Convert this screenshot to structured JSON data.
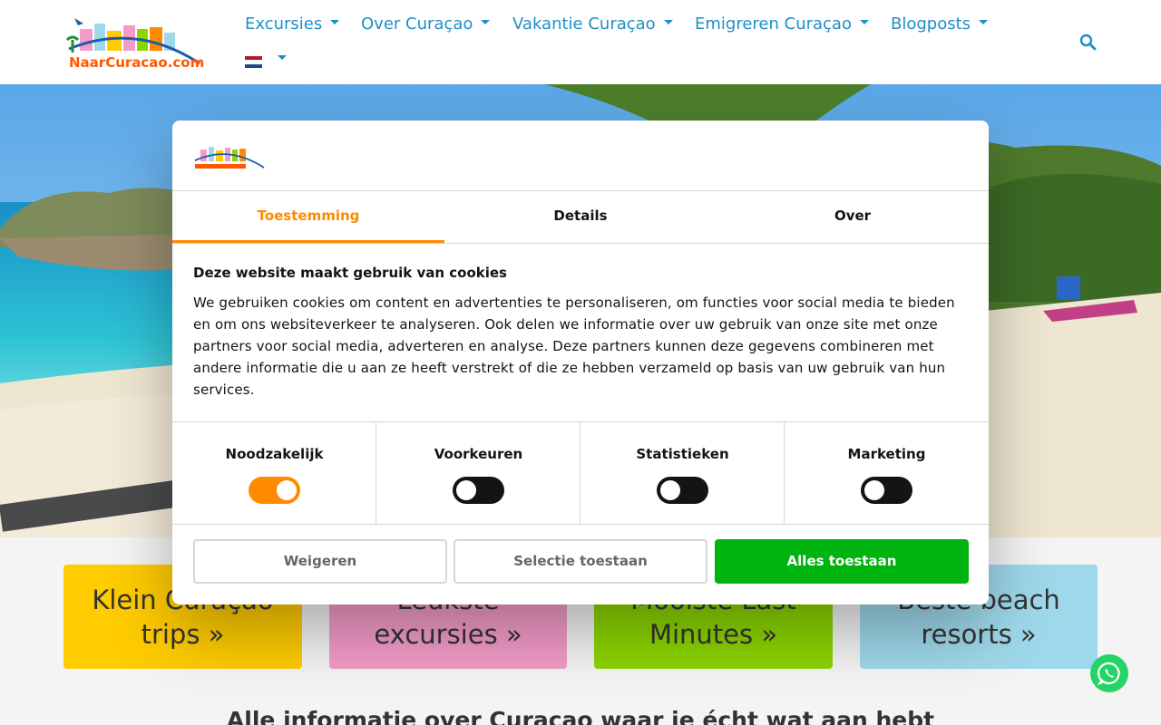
{
  "header": {
    "nav": [
      {
        "label": "Excursies"
      },
      {
        "label": "Over Curaçao"
      },
      {
        "label": "Vakantie Curaçao"
      },
      {
        "label": "Emigreren Curaçao"
      },
      {
        "label": "Blogposts"
      }
    ],
    "logo_text": "NaarCuracao.com",
    "language": "nl"
  },
  "tiles": [
    {
      "label": "Klein Curaçao trips »",
      "color": "#ffcc00"
    },
    {
      "label": "Leukste excursies »",
      "color": "#f39cc8"
    },
    {
      "label": "Mooiste Last Minutes »",
      "color": "#8bd500"
    },
    {
      "label": "Beste beach resorts »",
      "color": "#9ed9eb"
    }
  ],
  "main": {
    "heading": "Alle informatie over Curaçao waar je écht wat aan hebt"
  },
  "cookie_dialog": {
    "tabs": [
      "Toestemming",
      "Details",
      "Over"
    ],
    "active_tab": "Toestemming",
    "title": "Deze website maakt gebruik van cookies",
    "body": "We gebruiken cookies om content en advertenties te personaliseren, om functies voor social media te bieden en om ons websiteverkeer te analyseren. Ook delen we informatie over uw gebruik van onze site met onze partners voor social media, adverteren en analyse. Deze partners kunnen deze gegevens combineren met andere informatie die u aan ze heeft verstrekt of die ze hebben verzameld op basis van uw gebruik van hun services.",
    "toggles": [
      {
        "label": "Noodzakelijk",
        "on": true
      },
      {
        "label": "Voorkeuren",
        "on": false
      },
      {
        "label": "Statistieken",
        "on": false
      },
      {
        "label": "Marketing",
        "on": false
      }
    ],
    "buttons": {
      "reject": "Weigeren",
      "select": "Selectie toestaan",
      "accept_all": "Alles toestaan"
    },
    "accent_color": "#ff8a00",
    "accept_color": "#00b40f"
  }
}
